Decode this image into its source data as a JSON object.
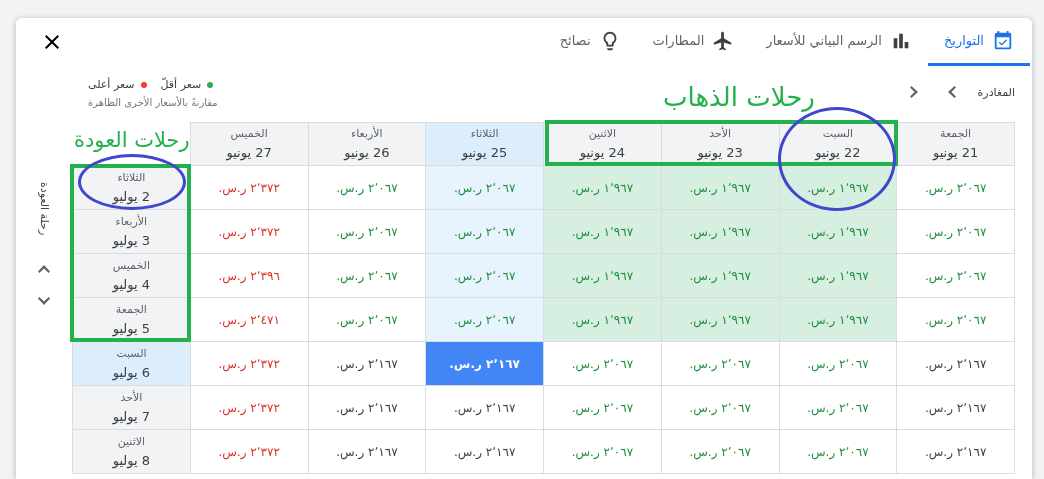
{
  "tabs": [
    {
      "label": "التواريخ",
      "selected": true
    },
    {
      "label": "الرسم البياني للأسعار",
      "selected": false
    },
    {
      "label": "المطارات",
      "selected": false
    },
    {
      "label": "نصائح",
      "selected": false
    }
  ],
  "departure_label": "المغادرة",
  "legend": {
    "items": [
      {
        "label": "سعر أقلّ",
        "color": "#34a853"
      },
      {
        "label": "سعر أعلى",
        "color": "#ea4335"
      }
    ],
    "note": "مقارنةً بالأسعار الأخرى الظاهرة"
  },
  "return_label": "رحلة العودة",
  "columns": [
    {
      "day": "الجمعة",
      "date": "21 يونيو",
      "selected": false
    },
    {
      "day": "السبت",
      "date": "22 يونيو",
      "selected": false
    },
    {
      "day": "الأحد",
      "date": "23 يونيو",
      "selected": false
    },
    {
      "day": "الاثنين",
      "date": "24 يونيو",
      "selected": false
    },
    {
      "day": "الثلاثاء",
      "date": "25 يونيو",
      "selected": true
    },
    {
      "day": "الأربعاء",
      "date": "26 يونيو",
      "selected": false
    },
    {
      "day": "الخميس",
      "date": "27 يونيو",
      "selected": false
    }
  ],
  "rows": [
    {
      "day": "الثلاثاء",
      "date": "2 يوليو",
      "selected": false,
      "cells": [
        {
          "price": "٢٬٠٦٧ ر.س.",
          "kind": "low",
          "highlighted": false
        },
        {
          "price": "١٬٩٦٧ ر.س.",
          "kind": "low",
          "highlighted": true
        },
        {
          "price": "١٬٩٦٧ ر.س.",
          "kind": "low",
          "highlighted": true
        },
        {
          "price": "١٬٩٦٧ ر.س.",
          "kind": "low",
          "highlighted": true
        },
        {
          "price": "٢٬٠٦٧ ر.س.",
          "kind": "low",
          "highlighted": false
        },
        {
          "price": "٢٬٠٦٧ ر.س.",
          "kind": "low",
          "highlighted": false
        },
        {
          "price": "٢٬٣٧٢ ر.س.",
          "kind": "high",
          "highlighted": false
        }
      ]
    },
    {
      "day": "الأربعاء",
      "date": "3 يوليو",
      "selected": false,
      "cells": [
        {
          "price": "٢٬٠٦٧ ر.س.",
          "kind": "low",
          "highlighted": false
        },
        {
          "price": "١٬٩٦٧ ر.س.",
          "kind": "low",
          "highlighted": true
        },
        {
          "price": "١٬٩٦٧ ر.س.",
          "kind": "low",
          "highlighted": true
        },
        {
          "price": "١٬٩٦٧ ر.س.",
          "kind": "low",
          "highlighted": true
        },
        {
          "price": "٢٬٠٦٧ ر.س.",
          "kind": "low",
          "highlighted": false
        },
        {
          "price": "٢٬٠٦٧ ر.س.",
          "kind": "low",
          "highlighted": false
        },
        {
          "price": "٢٬٣٧٢ ر.س.",
          "kind": "high",
          "highlighted": false
        }
      ]
    },
    {
      "day": "الخميس",
      "date": "4 يوليو",
      "selected": false,
      "cells": [
        {
          "price": "٢٬٠٦٧ ر.س.",
          "kind": "low",
          "highlighted": false
        },
        {
          "price": "١٬٩٦٧ ر.س.",
          "kind": "low",
          "highlighted": true
        },
        {
          "price": "١٬٩٦٧ ر.س.",
          "kind": "low",
          "highlighted": true
        },
        {
          "price": "١٬٩٦٧ ر.س.",
          "kind": "low",
          "highlighted": true
        },
        {
          "price": "٢٬٠٦٧ ر.س.",
          "kind": "low",
          "highlighted": false
        },
        {
          "price": "٢٬٠٦٧ ر.س.",
          "kind": "low",
          "highlighted": false
        },
        {
          "price": "٢٬٣٩٦ ر.س.",
          "kind": "high",
          "highlighted": false
        }
      ]
    },
    {
      "day": "الجمعة",
      "date": "5 يوليو",
      "selected": false,
      "cells": [
        {
          "price": "٢٬٠٦٧ ر.س.",
          "kind": "low",
          "highlighted": false
        },
        {
          "price": "١٬٩٦٧ ر.س.",
          "kind": "low",
          "highlighted": true
        },
        {
          "price": "١٬٩٦٧ ر.س.",
          "kind": "low",
          "highlighted": true
        },
        {
          "price": "١٬٩٦٧ ر.س.",
          "kind": "low",
          "highlighted": true
        },
        {
          "price": "٢٬٠٦٧ ر.س.",
          "kind": "low",
          "highlighted": false
        },
        {
          "price": "٢٬٠٦٧ ر.س.",
          "kind": "low",
          "highlighted": false
        },
        {
          "price": "٢٬٤٧١ ر.س.",
          "kind": "high",
          "highlighted": false
        }
      ]
    },
    {
      "day": "السبت",
      "date": "6 يوليو",
      "selected": true,
      "cells": [
        {
          "price": "٢٬١٦٧ ر.س.",
          "kind": "normal",
          "highlighted": false
        },
        {
          "price": "٢٬٠٦٧ ر.س.",
          "kind": "low",
          "highlighted": false
        },
        {
          "price": "٢٬٠٦٧ ر.س.",
          "kind": "low",
          "highlighted": false
        },
        {
          "price": "٢٬٠٦٧ ر.س.",
          "kind": "low",
          "highlighted": false
        },
        {
          "price": "٢٬١٦٧ ر.س.",
          "kind": "normal",
          "highlighted": false
        },
        {
          "price": "٢٬١٦٧ ر.س.",
          "kind": "normal",
          "highlighted": false
        },
        {
          "price": "٢٬٣٧٢ ر.س.",
          "kind": "high",
          "highlighted": false
        }
      ]
    },
    {
      "day": "الأحد",
      "date": "7 يوليو",
      "selected": false,
      "cells": [
        {
          "price": "٢٬١٦٧ ر.س.",
          "kind": "normal",
          "highlighted": false
        },
        {
          "price": "٢٬٠٦٧ ر.س.",
          "kind": "low",
          "highlighted": false
        },
        {
          "price": "٢٬٠٦٧ ر.س.",
          "kind": "low",
          "highlighted": false
        },
        {
          "price": "٢٬٠٦٧ ر.س.",
          "kind": "low",
          "highlighted": false
        },
        {
          "price": "٢٬١٦٧ ر.س.",
          "kind": "normal",
          "highlighted": false
        },
        {
          "price": "٢٬١٦٧ ر.س.",
          "kind": "normal",
          "highlighted": false
        },
        {
          "price": "٢٬٣٧٢ ر.س.",
          "kind": "high",
          "highlighted": false
        }
      ]
    },
    {
      "day": "الاثنين",
      "date": "8 يوليو",
      "selected": false,
      "cells": [
        {
          "price": "٢٬١٦٧ ر.س.",
          "kind": "normal",
          "highlighted": false
        },
        {
          "price": "٢٬٠٦٧ ر.س.",
          "kind": "low",
          "highlighted": false
        },
        {
          "price": "٢٬٠٦٧ ر.س.",
          "kind": "low",
          "highlighted": false
        },
        {
          "price": "٢٬٠٦٧ ر.س.",
          "kind": "low",
          "highlighted": false
        },
        {
          "price": "٢٬١٦٧ ر.س.",
          "kind": "normal",
          "highlighted": false
        },
        {
          "price": "٢٬١٦٧ ر.س.",
          "kind": "normal",
          "highlighted": false
        },
        {
          "price": "٢٬٣٧٢ ر.س.",
          "kind": "high",
          "highlighted": false
        }
      ]
    }
  ],
  "annotations": [
    {
      "kind": "text",
      "text": "رحلات الذهاب",
      "color": "#22b14c"
    },
    {
      "kind": "text",
      "text": "رحلات العودة",
      "color": "#22b14c"
    },
    {
      "kind": "rectangle",
      "color": "#22b14c"
    },
    {
      "kind": "rectangle",
      "color": "#22b14c"
    },
    {
      "kind": "ellipse",
      "color": "#3f48cc"
    },
    {
      "kind": "ellipse",
      "color": "#3f48cc"
    }
  ]
}
